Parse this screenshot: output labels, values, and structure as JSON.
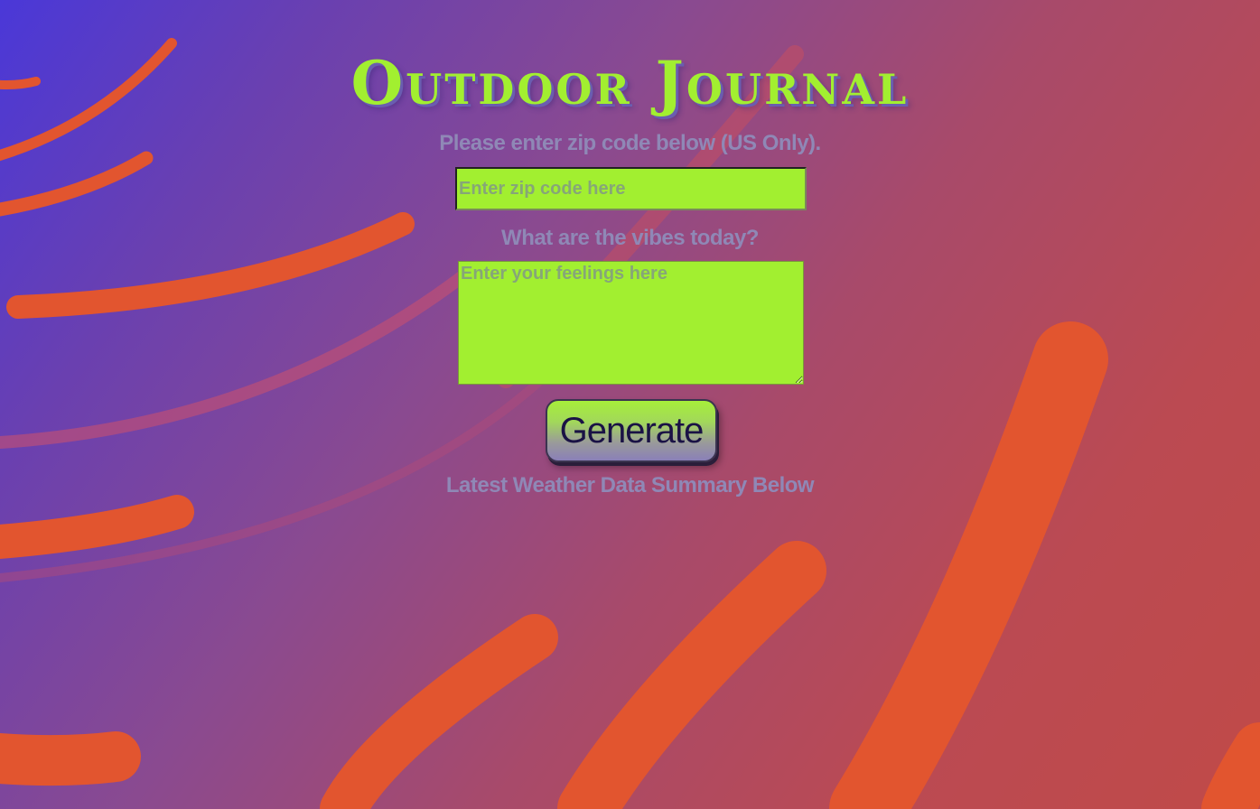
{
  "app": {
    "title": "Outdoor Journal"
  },
  "zip": {
    "label": "Please enter zip code below (US Only).",
    "placeholder": "Enter zip code here",
    "value": ""
  },
  "feelings": {
    "label": "What are the vibes today?",
    "placeholder": "Enter your feelings here",
    "value": ""
  },
  "actions": {
    "generate_label": "Generate"
  },
  "weather": {
    "title": "Latest Weather Data Summary Below"
  },
  "colors": {
    "accent": "#a2ef30",
    "label": "#8f88b6",
    "button_text": "#1a1245",
    "swirl": "#e2552f",
    "bg_start": "#4a38d8",
    "bg_end": "#c04a48"
  }
}
